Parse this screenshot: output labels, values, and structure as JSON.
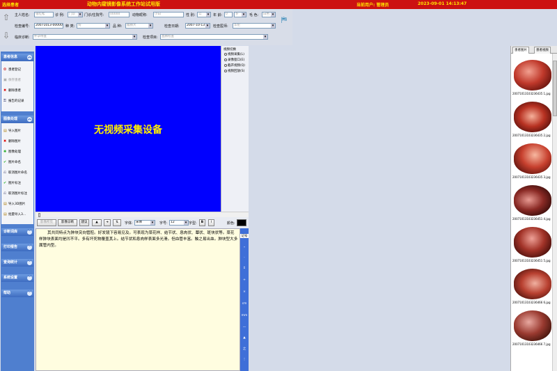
{
  "header": {
    "left_label": "选择患者",
    "title": "动物内窥镜影像系统工作站试用版",
    "current_user": "当前用户: 管理员",
    "datetime": "2023-09-01 14:13:47"
  },
  "form": {
    "owner_name_label": "主人姓名:",
    "owner_name_placeholder": "张红松",
    "diagnosis_label": "诊  例:",
    "diagnosis_value": "门诊",
    "clinic_label": "门诊/住院号:",
    "clinic_placeholder": "00000",
    "animal_label": "动物昵称:",
    "animal_placeholder": "小白",
    "gender_label": "性  别:",
    "gender_value": "公",
    "age_label": "年  龄:",
    "age_value": "0",
    "age_unit": "岁",
    "color_label": "毛  色:",
    "color_value": "白色",
    "exam_no_label": "检查编号:",
    "exam_no_value": "20071013-000001",
    "species_label": "种  类:",
    "species_value": "狗",
    "breed_label": "品  种:",
    "breed_value": "腊肠犬",
    "exam_date_label": "检查日期:",
    "exam_date_value": "2007-10-13",
    "exam_doctor_label": "检查医师:",
    "exam_doctor_value": "华伦",
    "clinical_label": "临床诊断:",
    "clinical_value": "怀孕待查",
    "exam_item_label": "检查项目:",
    "exam_item_value": "直肠检查"
  },
  "sidebar": {
    "sections": [
      {
        "title": "患者信息",
        "items": [
          "患者登记",
          "保存患者",
          "删除患者",
          "报告的记录"
        ]
      },
      {
        "title": "图像处理",
        "items": [
          "导入图片",
          "删除图片",
          "图像处理",
          "图片命名",
          "取消图片命名",
          "图片标注",
          "取消图片标注",
          "导入3D图片",
          "批量导入3..."
        ]
      },
      {
        "title": "诊断词库"
      },
      {
        "title": "打印报告"
      },
      {
        "title": "查询统计"
      },
      {
        "title": "系统设置"
      },
      {
        "title": "帮助"
      }
    ]
  },
  "video": {
    "no_device": "无视频采集设备",
    "panel_title": "视频切换",
    "options": [
      "视频采集(L)",
      "录像窗口(E)",
      "截开视频(Q)",
      "视频回放(S)"
    ]
  },
  "toolbar": {
    "btn_image_report": "影像所见",
    "btn_image_diag": "影像诊断",
    "btn_advice": "建议",
    "btn_up": "▲",
    "btn_right": "➔",
    "btn_sort": "⇅",
    "font_label": "字体:",
    "font_value": "宋体",
    "size_label": "字号:",
    "size_value": "12",
    "style_label": "字型:",
    "bold": "B",
    "italic": "I",
    "color_label": "颜色:"
  },
  "editor": {
    "text": "其共同特点为肿块突向管腔。好发镜下容易见及。可表现为菜花样、结节状、息肉状、蕈状、斑块状等。菜花样肿块表面均是凹不平。多有坏死物覆盖其上。结节状和息肉样表面多光滑。但血管丰富。触之易出血。肿块型大多属管内型。"
  },
  "side_symbols": [
    "记号",
    "∘",
    "·",
    "↕",
    "+",
    "×",
    "cm",
    "mm",
    "—",
    "▲",
    "之",
    "⋮"
  ],
  "thumb_panel": {
    "tab_active": "患者图片",
    "tab_other": "患者视频",
    "captions": [
      "20071013103236435 1.jpg",
      "20071013103236435 2.jpg",
      "20071013103236435 3.jpg",
      "20071013103236451 4.jpg",
      "20071013103236451 5.jpg",
      "20071013103236466 6.jpg",
      "20071013103236466 7.jpg"
    ]
  },
  "colors": {
    "header_bg": "#cc1111",
    "header_text": "#ffe400",
    "video_bg": "#0000ff",
    "sidebar_bg": "#4f7fcf",
    "editor_bg": "#fffde0"
  }
}
